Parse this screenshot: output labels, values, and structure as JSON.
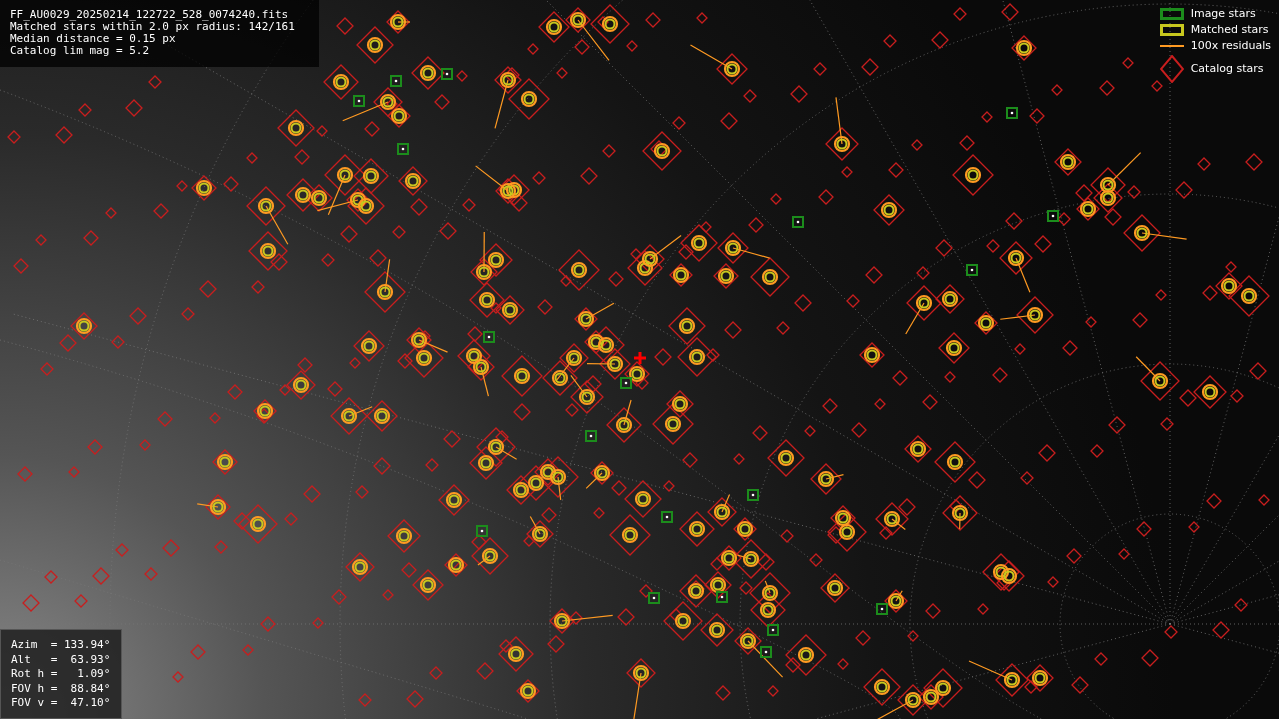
{
  "info_box": {
    "lines": [
      "FF_AU0029_20250214_122722_528_0074240.fits",
      "Matched stars within 2.0 px radius: 142/161",
      "Median distance = 0.15 px",
      "Catalog lim mag = 5.2"
    ]
  },
  "legend": [
    {
      "kind": "image",
      "label": "Image stars",
      "color": "#1c8c1c"
    },
    {
      "kind": "matched",
      "label": "Matched stars",
      "color": "#c8c81e"
    },
    {
      "kind": "residual",
      "label": "100x residuals",
      "color": "#ff9a22"
    },
    {
      "kind": "catalog",
      "label": "Catalog stars",
      "color": "#c81e1e"
    }
  ],
  "pointing_box": {
    "lines": [
      "Azim  = 133.94°",
      "Alt   =  63.93°",
      "Rot h =   1.09°",
      "FOV h =  88.84°",
      "FOV v =  47.10°"
    ]
  }
}
